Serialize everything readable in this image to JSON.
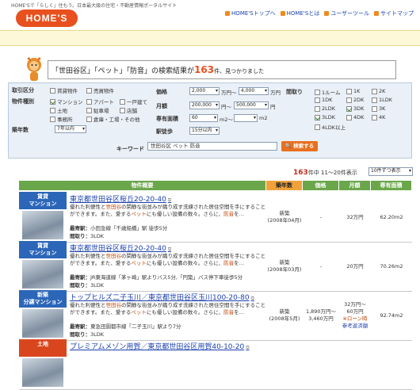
{
  "header": {
    "tagline": "HOME'Sで「らしく」住もう。日本最大級の住宅・不動産情報ポータルサイト",
    "logo": "HOME'S",
    "links": [
      "HOME'Sトップへ",
      "HOME'Sとは",
      "ユーザーツール",
      "サイトマップ"
    ]
  },
  "headline": {
    "prefix": "「世田谷区」「ペット」「防音」の検索結果が",
    "count": "163",
    "suffix": "件、見つかりました"
  },
  "search": {
    "labels": {
      "torihiki": "取引区分",
      "shubetsu": "物件種別",
      "chikunen": "築年数",
      "kakaku": "価格",
      "tsukigaku": "月額",
      "senyu": "専有面積",
      "ekitoho": "駅徒歩",
      "madori": "間取り",
      "keyword": "キーワード"
    },
    "torihiki": [
      "賃貸物件",
      "売買物件"
    ],
    "shubetsu": [
      "マンション",
      "アパート",
      "一戸建て",
      "土地",
      "駐車場",
      "店舗",
      "事務所",
      "倉庫・工場・その他"
    ],
    "chikunen": "7年以内",
    "price_from": "2,000",
    "price_to": "4,000",
    "price_unit": "万円〜",
    "price_unit2": "万円",
    "monthly_from": "200,000",
    "monthly_to": "500,000",
    "monthly_unit": "円〜",
    "monthly_unit2": "円",
    "area_from": "60",
    "area_to": "",
    "area_unit": "m2〜",
    "area_unit2": "m2",
    "walk": "15分以内",
    "madori": [
      "1ルーム",
      "1K",
      "2K",
      "1DK",
      "2DK",
      "1LDK",
      "2LDK",
      "3DK",
      "3K",
      "3LDK",
      "4DK",
      "4K",
      "4LDK以上"
    ],
    "keyword_value": "世田谷区 ペット 防音",
    "search_button": "検索する"
  },
  "results": {
    "count": "163",
    "range": "件中 11〜20件表示",
    "per_page": "10件ずつ表示"
  },
  "table": {
    "headers": [
      "物件概要",
      "築年数",
      "価格",
      "月額",
      "専有面積"
    ]
  },
  "listings": [
    {
      "category": "賃貸\nマンション",
      "color": "#2b66b8",
      "title": "東京都世田谷区桜丘20-20-40",
      "desc_a": "優れた利便性と",
      "desc_em1": "世田谷",
      "desc_b": "の閑静な街並みが織り成す洗練された居住空間を手にすることができます。また、愛する",
      "desc_em2": "ペット",
      "desc_c": "にも優しい設備の数々。さらに、",
      "desc_em3": "防音",
      "desc_d": "を…",
      "access_label": "最寄駅：",
      "access": "小田急線「千歳船橋」駅 徒歩5分",
      "layout_label": "間取り：",
      "layout": "3LDK",
      "age": "新築",
      "age2": "(2008年04月)",
      "price": "-",
      "monthly": "32万円",
      "monthly2": "",
      "area": "62.20m2",
      "note": ""
    },
    {
      "category": "賃貸\nマンション",
      "color": "#2b66b8",
      "title": "東京都世田谷区桜丘20-20-40",
      "desc_a": "優れた利便性と",
      "desc_em1": "世田谷",
      "desc_b": "の閑静な街並みが織り成す洗練された居住空間を手にすることができます。また、愛する",
      "desc_em2": "ペット",
      "desc_c": "にも優しい設備の数々。さらに、",
      "desc_em3": "防音",
      "desc_d": "を…",
      "access_label": "最寄駅：",
      "access": "JR東海道線「茅ヶ崎」駅よりバス5分,「円築」バス停下車徒歩5分",
      "layout_label": "間取り：",
      "layout": "3LDK",
      "age": "新築",
      "age2": "(2008年03月)",
      "price": "-",
      "monthly": "20万円",
      "monthly2": "",
      "area": "70.26m2",
      "note": ""
    },
    {
      "category": "新築\n分譲マンション",
      "color": "#2b66b8",
      "title": "トップヒルズ二子玉川／東京都世田谷区玉川100-20-80",
      "desc_a": "優れた利便性と",
      "desc_em1": "世田谷",
      "desc_b": "の閑静な街並みが織り成す洗練された居住空間を手にすることができます。また、愛する",
      "desc_em2": "ペット",
      "desc_c": "にも優しい設備の数々。さらに、",
      "desc_em3": "防音",
      "desc_d": "を…",
      "access_label": "最寄駅：",
      "access": "東急田園都市線「二子玉川」駅より7分",
      "layout_label": "間取り：",
      "layout": "3LDK",
      "age": "新築",
      "age2": "(2008年5月)",
      "price": "1,890万円〜",
      "price2": "3,460万円",
      "monthly": "32万円〜",
      "monthly2": "60万円",
      "area": "92.74m2",
      "note": "※ローン時",
      "note2": "参考返済額"
    },
    {
      "category": "土地",
      "color": "#d9461e",
      "title": "プレミアムメゾン用賀／東京都世田谷区用賀40-10-20",
      "desc_a": "",
      "desc_em1": "",
      "desc_b": "",
      "desc_em2": "",
      "desc_c": "",
      "desc_em3": "",
      "desc_d": "",
      "access_label": "",
      "access": "",
      "layout_label": "",
      "layout": "",
      "age": "",
      "age2": "",
      "price": "",
      "monthly": "",
      "monthly2": "",
      "area": "",
      "note": ""
    }
  ]
}
